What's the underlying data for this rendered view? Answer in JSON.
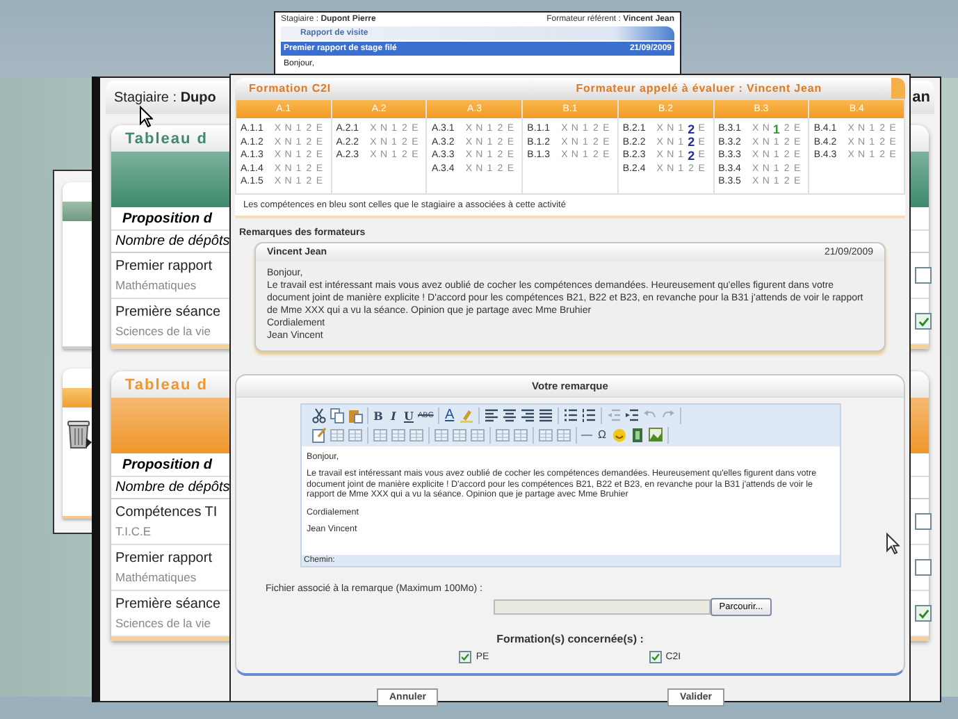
{
  "top_window": {
    "trainee": "Stagiaire : **Dupont Pierre**",
    "referent": "Formateur référent : **Vincent Jean**",
    "section": "Rapport de visite",
    "rows": [
      {
        "title": "Premier rapport de stage filé",
        "date": "21/09/2009",
        "selected": true
      }
    ],
    "preview": "Bonjour,"
  },
  "main_window": {
    "trainee": "Stagiaire : **Dupo**",
    "header_right": "an",
    "tables": [
      {
        "title": "Tableau d",
        "color": "#3d8a6c",
        "proposition": "Proposition d",
        "count_label": "Nombre de dépôts",
        "rows": [
          {
            "title": "Premier rapport",
            "subtitle": "Mathématiques",
            "checked": false
          },
          {
            "title": "Première séance",
            "subtitle": "Sciences de la vie",
            "checked": true
          }
        ]
      },
      {
        "title": "Tableau d",
        "color": "#f0962a",
        "proposition": "Proposition d",
        "count_label": "Nombre de dépôts",
        "rows": [
          {
            "title": "Compétences TI",
            "subtitle": "T.I.C.E",
            "checked": false
          },
          {
            "title": "Premier rapport",
            "subtitle": "Mathématiques",
            "checked": false
          },
          {
            "title": "Première séance",
            "subtitle": "Sciences de la vie",
            "checked": true
          }
        ]
      }
    ]
  },
  "dialog": {
    "formation": "Formation C2I",
    "evaluator": "Formateur appelé à évaluer : Vincent Jean",
    "domains": [
      {
        "name": "A.1",
        "items": [
          {
            "code": "A.1.1",
            "marks": [
              {
                "label": "X",
                "selected": false
              },
              {
                "label": "N",
                "selected": false
              },
              {
                "label": "1",
                "selected": false
              },
              {
                "label": "2",
                "selected": false
              },
              {
                "label": "E",
                "selected": false
              }
            ]
          },
          {
            "code": "A.1.2",
            "marks": [
              {
                "label": "X",
                "selected": false
              },
              {
                "label": "N",
                "selected": false
              },
              {
                "label": "1",
                "selected": false
              },
              {
                "label": "2",
                "selected": false
              },
              {
                "label": "E",
                "selected": false
              }
            ]
          },
          {
            "code": "A.1.3",
            "marks": [
              {
                "label": "X",
                "selected": false
              },
              {
                "label": "N",
                "selected": false
              },
              {
                "label": "1",
                "selected": false
              },
              {
                "label": "2",
                "selected": false
              },
              {
                "label": "E",
                "selected": false
              }
            ]
          },
          {
            "code": "A.1.4",
            "marks": [
              {
                "label": "X",
                "selected": false
              },
              {
                "label": "N",
                "selected": false
              },
              {
                "label": "1",
                "selected": false
              },
              {
                "label": "2",
                "selected": false
              },
              {
                "label": "E",
                "selected": false
              }
            ]
          },
          {
            "code": "A.1.5",
            "marks": [
              {
                "label": "X",
                "selected": false
              },
              {
                "label": "N",
                "selected": false
              },
              {
                "label": "1",
                "selected": false
              },
              {
                "label": "2",
                "selected": false
              },
              {
                "label": "E",
                "selected": false
              }
            ]
          }
        ]
      },
      {
        "name": "A.2",
        "items": [
          {
            "code": "A.2.1",
            "marks": [
              {
                "label": "X",
                "selected": false
              },
              {
                "label": "N",
                "selected": false
              },
              {
                "label": "1",
                "selected": false
              },
              {
                "label": "2",
                "selected": false
              },
              {
                "label": "E",
                "selected": false
              }
            ]
          },
          {
            "code": "A.2.2",
            "marks": [
              {
                "label": "X",
                "selected": false
              },
              {
                "label": "N",
                "selected": false
              },
              {
                "label": "1",
                "selected": false
              },
              {
                "label": "2",
                "selected": false
              },
              {
                "label": "E",
                "selected": false
              }
            ]
          },
          {
            "code": "A.2.3",
            "marks": [
              {
                "label": "X",
                "selected": false
              },
              {
                "label": "N",
                "selected": false
              },
              {
                "label": "1",
                "selected": false
              },
              {
                "label": "2",
                "selected": false
              },
              {
                "label": "E",
                "selected": false
              }
            ]
          }
        ]
      },
      {
        "name": "A.3",
        "items": [
          {
            "code": "A.3.1",
            "marks": [
              {
                "label": "X",
                "selected": false
              },
              {
                "label": "N",
                "selected": false
              },
              {
                "label": "1",
                "selected": false
              },
              {
                "label": "2",
                "selected": false
              },
              {
                "label": "E",
                "selected": false
              }
            ]
          },
          {
            "code": "A.3.2",
            "marks": [
              {
                "label": "X",
                "selected": false
              },
              {
                "label": "N",
                "selected": false
              },
              {
                "label": "1",
                "selected": false
              },
              {
                "label": "2",
                "selected": false
              },
              {
                "label": "E",
                "selected": false
              }
            ]
          },
          {
            "code": "A.3.3",
            "marks": [
              {
                "label": "X",
                "selected": false
              },
              {
                "label": "N",
                "selected": false
              },
              {
                "label": "1",
                "selected": false
              },
              {
                "label": "2",
                "selected": false
              },
              {
                "label": "E",
                "selected": false
              }
            ]
          },
          {
            "code": "A.3.4",
            "marks": [
              {
                "label": "X",
                "selected": false
              },
              {
                "label": "N",
                "selected": false
              },
              {
                "label": "1",
                "selected": false
              },
              {
                "label": "2",
                "selected": false
              },
              {
                "label": "E",
                "selected": false
              }
            ]
          }
        ]
      },
      {
        "name": "B.1",
        "items": [
          {
            "code": "B.1.1",
            "marks": [
              {
                "label": "X",
                "selected": false
              },
              {
                "label": "N",
                "selected": false
              },
              {
                "label": "1",
                "selected": false
              },
              {
                "label": "2",
                "selected": false
              },
              {
                "label": "E",
                "selected": false
              }
            ]
          },
          {
            "code": "B.1.2",
            "marks": [
              {
                "label": "X",
                "selected": false
              },
              {
                "label": "N",
                "selected": false
              },
              {
                "label": "1",
                "selected": false
              },
              {
                "label": "2",
                "selected": false
              },
              {
                "label": "E",
                "selected": false
              }
            ]
          },
          {
            "code": "B.1.3",
            "marks": [
              {
                "label": "X",
                "selected": false
              },
              {
                "label": "N",
                "selected": false
              },
              {
                "label": "1",
                "selected": false
              },
              {
                "label": "2",
                "selected": false
              },
              {
                "label": "E",
                "selected": false
              }
            ]
          }
        ]
      },
      {
        "name": "B.2",
        "items": [
          {
            "code": "B.2.1",
            "marks": [
              {
                "label": "X",
                "selected": false
              },
              {
                "label": "N",
                "selected": false
              },
              {
                "label": "1",
                "selected": false
              },
              {
                "label": "2",
                "selected": true,
                "color": "#2a2f9c"
              },
              {
                "label": "E",
                "selected": false
              }
            ]
          },
          {
            "code": "B.2.2",
            "marks": [
              {
                "label": "X",
                "selected": false
              },
              {
                "label": "N",
                "selected": false
              },
              {
                "label": "1",
                "selected": false
              },
              {
                "label": "2",
                "selected": true,
                "color": "#2a2f9c"
              },
              {
                "label": "E",
                "selected": false
              }
            ]
          },
          {
            "code": "B.2.3",
            "marks": [
              {
                "label": "X",
                "selected": false
              },
              {
                "label": "N",
                "selected": false
              },
              {
                "label": "1",
                "selected": false
              },
              {
                "label": "2",
                "selected": true,
                "color": "#2a2f9c"
              },
              {
                "label": "E",
                "selected": false
              }
            ]
          },
          {
            "code": "B.2.4",
            "marks": [
              {
                "label": "X",
                "selected": false
              },
              {
                "label": "N",
                "selected": false
              },
              {
                "label": "1",
                "selected": false
              },
              {
                "label": "2",
                "selected": false
              },
              {
                "label": "E",
                "selected": false
              }
            ]
          }
        ]
      },
      {
        "name": "B.3",
        "items": [
          {
            "code": "B.3.1",
            "marks": [
              {
                "label": "X",
                "selected": false
              },
              {
                "label": "N",
                "selected": false
              },
              {
                "label": "1",
                "selected": true,
                "color": "#2f9a2f"
              },
              {
                "label": "2",
                "selected": false
              },
              {
                "label": "E",
                "selected": false
              }
            ]
          },
          {
            "code": "B.3.2",
            "marks": [
              {
                "label": "X",
                "selected": false
              },
              {
                "label": "N",
                "selected": false
              },
              {
                "label": "1",
                "selected": false
              },
              {
                "label": "2",
                "selected": false
              },
              {
                "label": "E",
                "selected": false
              }
            ]
          },
          {
            "code": "B.3.3",
            "marks": [
              {
                "label": "X",
                "selected": false
              },
              {
                "label": "N",
                "selected": false
              },
              {
                "label": "1",
                "selected": false
              },
              {
                "label": "2",
                "selected": false
              },
              {
                "label": "E",
                "selected": false
              }
            ]
          },
          {
            "code": "B.3.4",
            "marks": [
              {
                "label": "X",
                "selected": false
              },
              {
                "label": "N",
                "selected": false
              },
              {
                "label": "1",
                "selected": false
              },
              {
                "label": "2",
                "selected": false
              },
              {
                "label": "E",
                "selected": false
              }
            ]
          },
          {
            "code": "B.3.5",
            "marks": [
              {
                "label": "X",
                "selected": false
              },
              {
                "label": "N",
                "selected": false
              },
              {
                "label": "1",
                "selected": false
              },
              {
                "label": "2",
                "selected": false
              },
              {
                "label": "E",
                "selected": false
              }
            ]
          }
        ]
      },
      {
        "name": "B.4",
        "items": [
          {
            "code": "B.4.1",
            "marks": [
              {
                "label": "X",
                "selected": false
              },
              {
                "label": "N",
                "selected": false
              },
              {
                "label": "1",
                "selected": false
              },
              {
                "label": "2",
                "selected": false
              },
              {
                "label": "E",
                "selected": false
              }
            ]
          },
          {
            "code": "B.4.2",
            "marks": [
              {
                "label": "X",
                "selected": false
              },
              {
                "label": "N",
                "selected": false
              },
              {
                "label": "1",
                "selected": false
              },
              {
                "label": "2",
                "selected": false
              },
              {
                "label": "E",
                "selected": false
              }
            ]
          },
          {
            "code": "B.4.3",
            "marks": [
              {
                "label": "X",
                "selected": false
              },
              {
                "label": "N",
                "selected": false
              },
              {
                "label": "1",
                "selected": false
              },
              {
                "label": "2",
                "selected": false
              },
              {
                "label": "E",
                "selected": false
              }
            ]
          }
        ]
      }
    ],
    "legend": "Les compétences en bleu sont celles que le stagiaire a associées à cette activité",
    "remarks_title": "Remarques des formateurs",
    "remarks": [
      {
        "author": "Vincent Jean",
        "date": "21/09/2009",
        "lines": [
          "Bonjour,",
          "Le travail est intéressant mais vous avez oublié de cocher les compétences demandées. Heureusement qu'elles figurent dans votre document joint de manière explicite !  D'accord pour les compétences B21, B22 et B23, en revanche pour la B31 j'attends de voir le rapport de Mme XXX qui a vu la séance. Opinion que je partage avec Mme Bruhier",
          "Cordialement",
          "Jean Vincent"
        ]
      }
    ],
    "editor": {
      "title": "Votre remarque",
      "toolbar": [
        [
          [
            {
              "kind": "cut",
              "disabled": false
            },
            {
              "kind": "copy",
              "disabled": false
            },
            {
              "kind": "paste",
              "disabled": false
            }
          ],
          [
            {
              "kind": "bold",
              "label": "B",
              "disabled": false
            },
            {
              "kind": "italic",
              "label": "I",
              "disabled": false
            },
            {
              "kind": "underline",
              "label": "U",
              "disabled": false
            },
            {
              "kind": "strike",
              "label": "ABC",
              "disabled": false
            }
          ],
          [
            {
              "kind": "forecolor",
              "label": "A",
              "disabled": false
            },
            {
              "kind": "highlight",
              "disabled": false
            }
          ],
          [
            {
              "kind": "align-left",
              "disabled": false
            },
            {
              "kind": "align-center",
              "disabled": false
            },
            {
              "kind": "align-right",
              "disabled": false
            },
            {
              "kind": "align-justify",
              "disabled": false
            }
          ],
          [
            {
              "kind": "bullets",
              "disabled": false
            },
            {
              "kind": "numbers",
              "disabled": false
            }
          ],
          [
            {
              "kind": "outdent",
              "disabled": true
            },
            {
              "kind": "indent",
              "disabled": false
            },
            {
              "kind": "undo",
              "disabled": true
            },
            {
              "kind": "redo",
              "disabled": true
            }
          ]
        ],
        [
          [
            {
              "kind": "note",
              "disabled": false
            },
            {
              "kind": "table",
              "disabled": true
            },
            {
              "kind": "table",
              "disabled": true
            }
          ],
          [
            {
              "kind": "table",
              "disabled": true
            },
            {
              "kind": "table",
              "disabled": true
            },
            {
              "kind": "table",
              "disabled": true
            }
          ],
          [
            {
              "kind": "table",
              "disabled": true
            },
            {
              "kind": "table",
              "disabled": true
            },
            {
              "kind": "table",
              "disabled": true
            }
          ],
          [
            {
              "kind": "table",
              "disabled": true
            },
            {
              "kind": "table",
              "disabled": true
            }
          ],
          [
            {
              "kind": "table",
              "disabled": true
            },
            {
              "kind": "table",
              "disabled": true
            }
          ],
          [
            {
              "kind": "char",
              "label": "—",
              "disabled": false
            },
            {
              "kind": "char",
              "label": "Ω",
              "disabled": false
            },
            {
              "kind": "smiley",
              "disabled": false
            },
            {
              "kind": "media",
              "disabled": false
            },
            {
              "kind": "image",
              "disabled": false
            }
          ]
        ]
      ],
      "paragraphs": [
        "Bonjour,",
        "Le travail est intéressant mais vous avez oublié de cocher les compétences demandées. Heureusement qu'elles figurent dans votre document joint de manière explicite !  D'accord pour les compétences B21, B22 et B23, en revanche pour la B31 j'attends de voir le rapport de Mme XXX qui a vu la séance. Opinion que je partage avec Mme Bruhier",
        "Cordialement",
        "Jean Vincent"
      ],
      "path_label": "Chemin:"
    },
    "file": {
      "label": "Fichier associé à la remarque (Maximum 100Mo) :",
      "button": "Parcourir..."
    },
    "formations": {
      "title": "Formation(s) concernée(s) :",
      "options": [
        {
          "label": "PE",
          "checked": true
        },
        {
          "label": "C2I",
          "checked": true
        }
      ]
    },
    "buttons": [
      {
        "label": "Annuler"
      },
      {
        "label": "Valider"
      }
    ]
  }
}
